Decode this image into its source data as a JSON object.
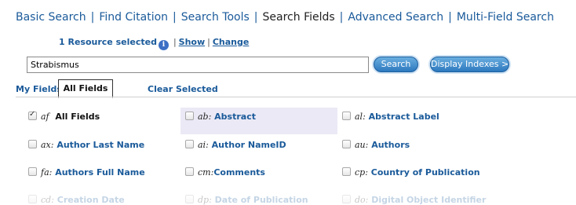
{
  "nav": {
    "items": [
      "Basic Search",
      "Find Citation",
      "Search Tools",
      "Search Fields",
      "Advanced Search",
      "Multi-Field Search"
    ],
    "active": "Search Fields"
  },
  "resources": {
    "count_text": "1 Resource selected",
    "info_glyph": "i",
    "show_label": "Show",
    "change_label": "Change",
    "separator": "|"
  },
  "search": {
    "value": "Strabismus",
    "search_button": "Search",
    "indexes_button": "Display Indexes >"
  },
  "tabs": {
    "my_fields": "My Fields",
    "all_fields": "All Fields",
    "clear_selected": "Clear Selected"
  },
  "fields": [
    {
      "code": "af",
      "label": "All Fields",
      "checked": true
    },
    {
      "code": "ab:",
      "label": "Abstract",
      "checked": false
    },
    {
      "code": "al:",
      "label": "Abstract Label",
      "checked": false
    },
    {
      "code": "ax:",
      "label": "Author Last Name",
      "checked": false
    },
    {
      "code": "ai:",
      "label": "Author NameID",
      "checked": false
    },
    {
      "code": "au:",
      "label": "Authors",
      "checked": false
    },
    {
      "code": "fa:",
      "label": "Authors Full Name",
      "checked": false
    },
    {
      "code": "cm:",
      "label": "Comments",
      "checked": false
    },
    {
      "code": "cp:",
      "label": "Country of Publication",
      "checked": false
    },
    {
      "code": "cd:",
      "label": "Creation Date",
      "checked": false
    },
    {
      "code": "dp:",
      "label": "Date of Publication",
      "checked": false
    },
    {
      "code": "do:",
      "label": "Digital Object Identifier",
      "checked": false
    }
  ]
}
